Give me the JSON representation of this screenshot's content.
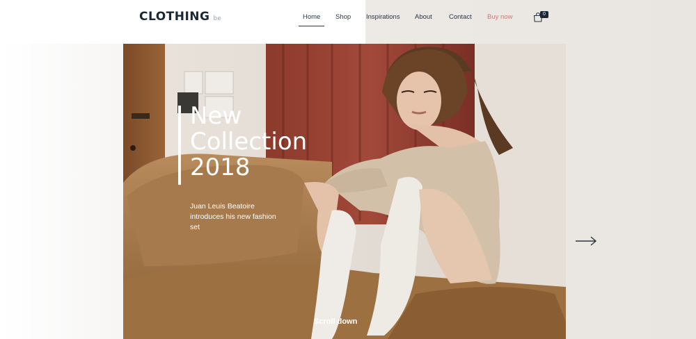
{
  "brand": {
    "name": "CLOTHING",
    "suffix": "be"
  },
  "nav": {
    "items": [
      {
        "label": "Home",
        "active": true
      },
      {
        "label": "Shop"
      },
      {
        "label": "Inspirations"
      },
      {
        "label": "About"
      },
      {
        "label": "Contact"
      },
      {
        "label": "Buy now"
      }
    ],
    "cart_count": "0"
  },
  "hero": {
    "title_lines": [
      "New",
      "Collection",
      "2018"
    ],
    "subtitle": "Juan Leuis Beatoire introduces his new fashion set",
    "scroll_label": "Scroll down"
  },
  "colors": {
    "brand_dark": "#1b2735",
    "buy_now": "#d07878",
    "text_light": "#ffffff"
  },
  "icons": {
    "cart": "shopping-bag-icon",
    "next": "arrow-right-icon"
  }
}
